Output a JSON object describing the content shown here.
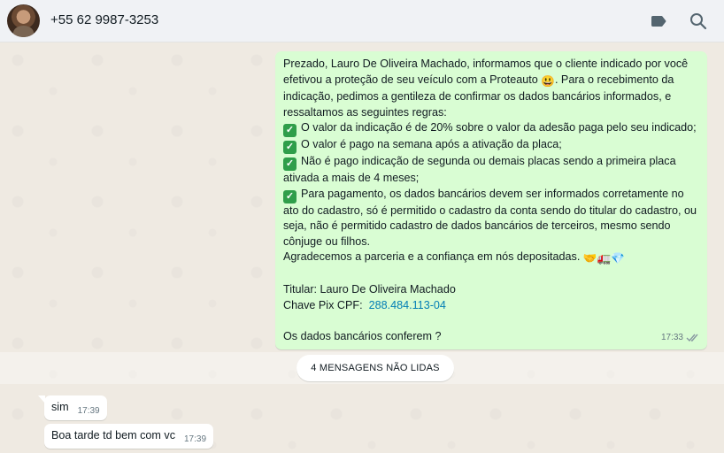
{
  "header": {
    "contact_name": "+55 62 9987-3253",
    "icons": [
      "label-icon",
      "search-icon"
    ]
  },
  "outgoing_message": {
    "intro": "Prezado, Lauro De Oliveira Machado, informamos que o cliente indicado por você efetivou a proteção de seu veículo com a Proteauto",
    "intro_emoji": "😃",
    "intro_rest": ". Para o recebimento da indicação, pedimos a gentileza de confirmar os dados bancários informados, e ressaltamos as seguintes regras:",
    "rules": [
      "O valor da indicação é de 20% sobre o valor da adesão paga pelo seu indicado;",
      "O valor é pago na semana após a ativação da placa;",
      "Não é pago indicação de segunda ou demais placas sendo a primeira placa ativada a mais de 4 meses;",
      "Para pagamento, os dados bancários devem ser informados corretamente no ato do cadastro, só é permitido o cadastro da conta sendo do titular do cadastro, ou seja, não é permitido cadastro de dados bancários de terceiros, mesmo sendo cônjuge ou filhos."
    ],
    "thanks": "Agradecemos a parceria e a confiança em nós depositadas.",
    "thanks_emojis": "🤝🚛💎",
    "holder_line": "Titular: Lauro De Oliveira Machado",
    "pix_label": "Chave Pix CPF:",
    "pix_value": "288.484.113-04",
    "question": "Os dados bancários conferem ?",
    "time": "17:33",
    "status": "read"
  },
  "unread_divider": "4 MENSAGENS NÃO LIDAS",
  "incoming_messages": [
    {
      "text": "sim",
      "time": "17:39"
    },
    {
      "text": "Boa tarde td bem com vc",
      "time": "17:39"
    }
  ],
  "colors": {
    "outgoing_bubble": "#d9fdd3",
    "incoming_bubble": "#ffffff",
    "chat_background": "#efeae2",
    "header_background": "#f0f2f5",
    "link": "#027eb5"
  }
}
